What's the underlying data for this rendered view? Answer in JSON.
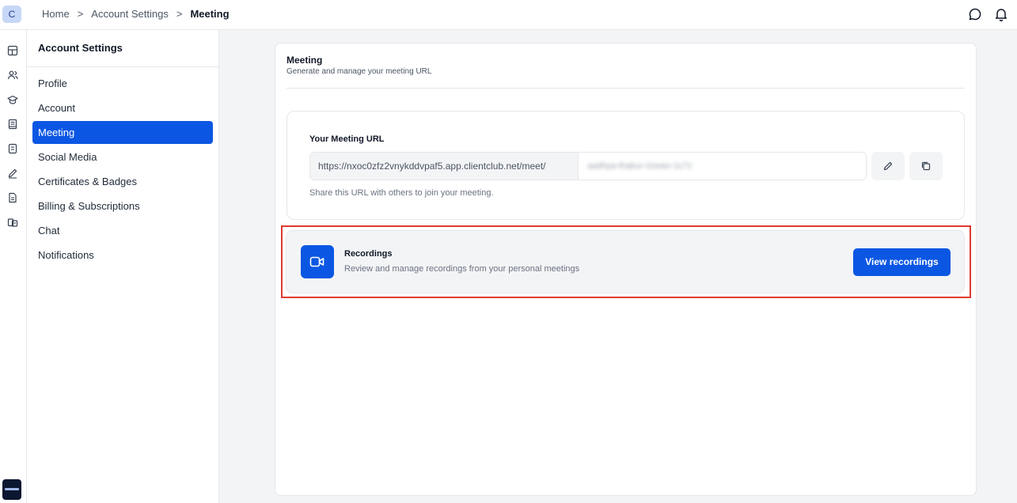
{
  "topbar": {
    "avatar_initial": "C",
    "breadcrumb": [
      "Home",
      "Account Settings",
      "Meeting"
    ],
    "separator": ">",
    "icons": [
      "chat-bubble-icon",
      "bell-icon"
    ]
  },
  "rail": {
    "icons": [
      "layout-icon",
      "users-icon",
      "graduation-cap-icon",
      "book-icon",
      "document-icon",
      "pen-icon",
      "file-text-icon",
      "courses-icon"
    ]
  },
  "settings": {
    "title": "Account Settings",
    "items": [
      {
        "label": "Profile"
      },
      {
        "label": "Account"
      },
      {
        "label": "Meeting",
        "active": true
      },
      {
        "label": "Social Media"
      },
      {
        "label": "Certificates & Badges"
      },
      {
        "label": "Billing & Subscriptions"
      },
      {
        "label": "Chat"
      },
      {
        "label": "Notifications"
      }
    ]
  },
  "meeting": {
    "title": "Meeting",
    "subtitle": "Generate and manage your meeting URL",
    "url_label": "Your Meeting URL",
    "url_prefix": "https://nxoc0zfz2vnykddvpaf5.app.clientclub.net/meet/",
    "url_slug": "aadhya-thakur-rizwan-1c7z",
    "url_help": "Share this URL with others to join your meeting.",
    "actions": [
      "pencil-icon",
      "copy-icon"
    ]
  },
  "recordings": {
    "title": "Recordings",
    "description": "Review and manage recordings from your personal meetings",
    "button_label": "View recordings",
    "icon": "video-camera-icon"
  },
  "colors": {
    "accent": "#0b57e3",
    "highlight_outline": "#e03a2f",
    "background": "#f3f4f6"
  }
}
